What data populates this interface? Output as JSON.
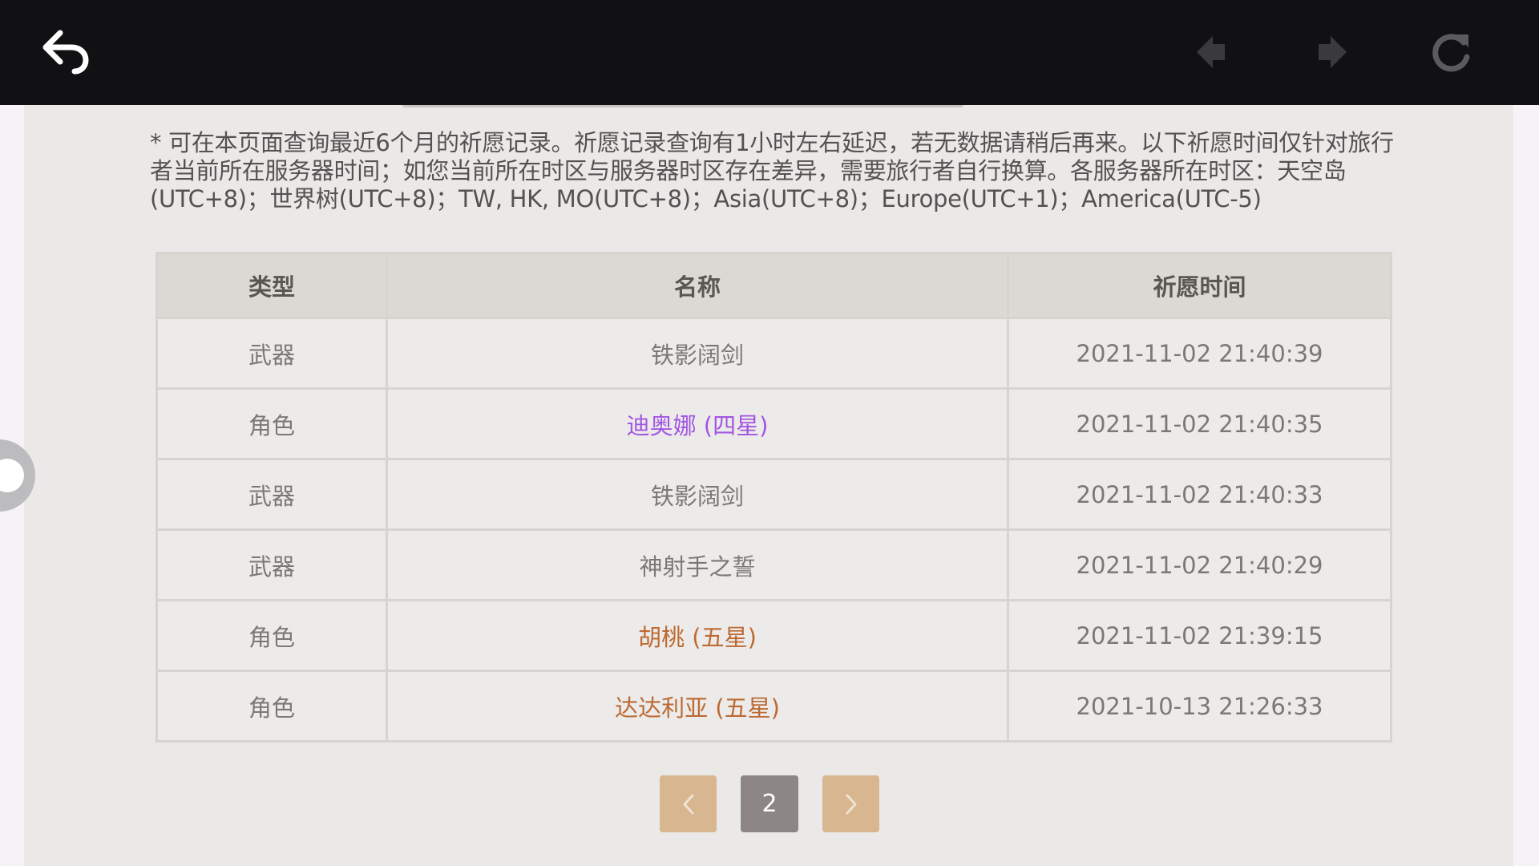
{
  "topbar": {
    "icons": {
      "back": "back-arrow-icon",
      "nav_prev": "navigate-back-icon",
      "nav_next": "navigate-forward-icon",
      "refresh": "refresh-icon"
    }
  },
  "notice": "* 可在本页面查询最近6个月的祈愿记录。祈愿记录查询有1小时左右延迟，若无数据请稍后再来。以下祈愿时间仅针对旅行者当前所在服务器时间；如您当前所在时区与服务器时区存在差异，需要旅行者自行换算。各服务器所在时区：天空岛(UTC+8)；世界树(UTC+8)；TW, HK, MO(UTC+8)；Asia(UTC+8)；Europe(UTC+1)；America(UTC-5)",
  "table": {
    "headers": [
      "类型",
      "名称",
      "祈愿时间"
    ],
    "rows": [
      {
        "type": "武器",
        "name": "铁影阔剑",
        "time": "2021-11-02 21:40:39",
        "rarity": 3
      },
      {
        "type": "角色",
        "name": "迪奥娜 (四星)",
        "time": "2021-11-02 21:40:35",
        "rarity": 4
      },
      {
        "type": "武器",
        "name": "铁影阔剑",
        "time": "2021-11-02 21:40:33",
        "rarity": 3
      },
      {
        "type": "武器",
        "name": "神射手之誓",
        "time": "2021-11-02 21:40:29",
        "rarity": 3
      },
      {
        "type": "角色",
        "name": "胡桃 (五星)",
        "time": "2021-11-02 21:39:15",
        "rarity": 5
      },
      {
        "type": "角色",
        "name": "达达利亚 (五星)",
        "time": "2021-10-13 21:26:33",
        "rarity": 5
      }
    ]
  },
  "pagination": {
    "current_page": "2",
    "prev_icon": "chevron-left-icon",
    "next_icon": "chevron-right-icon"
  },
  "colors": {
    "rarity_4": "#a256e1",
    "rarity_5": "#bd6932",
    "rarity_3": "#7c7876",
    "pager_button": "#d7b690",
    "pager_current": "#8c8784"
  }
}
